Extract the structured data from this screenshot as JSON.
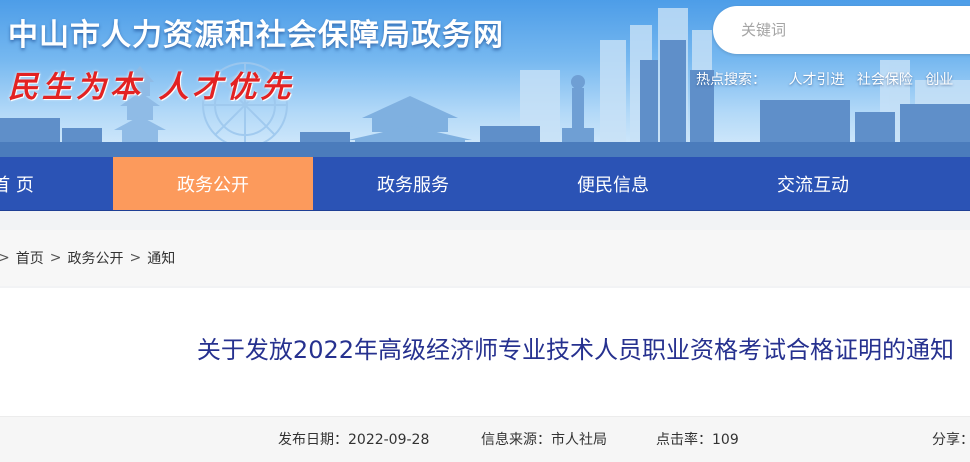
{
  "header": {
    "site_title": "中山市人力资源和社会保障局政务网",
    "slogan": "民生为本 人才优先",
    "search_placeholder": "关键词",
    "hot_label": "热点搜索：",
    "hot_links": [
      "人才引进",
      "社会保险",
      "创业"
    ]
  },
  "nav": {
    "items": [
      {
        "label": "首 页"
      },
      {
        "label": "政务公开"
      },
      {
        "label": "政务服务"
      },
      {
        "label": "便民信息"
      },
      {
        "label": "交流互动"
      }
    ],
    "active_index": 1
  },
  "breadcrumb": {
    "separator": ">",
    "items": [
      "首页",
      "政务公开",
      "通知"
    ]
  },
  "article": {
    "title": "关于发放2022年高级经济师专业技术人员职业资格考试合格证明的通知",
    "publish_date": "发布日期：2022-09-28",
    "source": "信息来源：市人社局",
    "hits": "点击率：109",
    "share": "分享："
  },
  "colors": {
    "nav_bg": "#2b53b5",
    "nav_active": "#fc9a5c",
    "title": "#26318f",
    "slogan": "#e32222"
  }
}
